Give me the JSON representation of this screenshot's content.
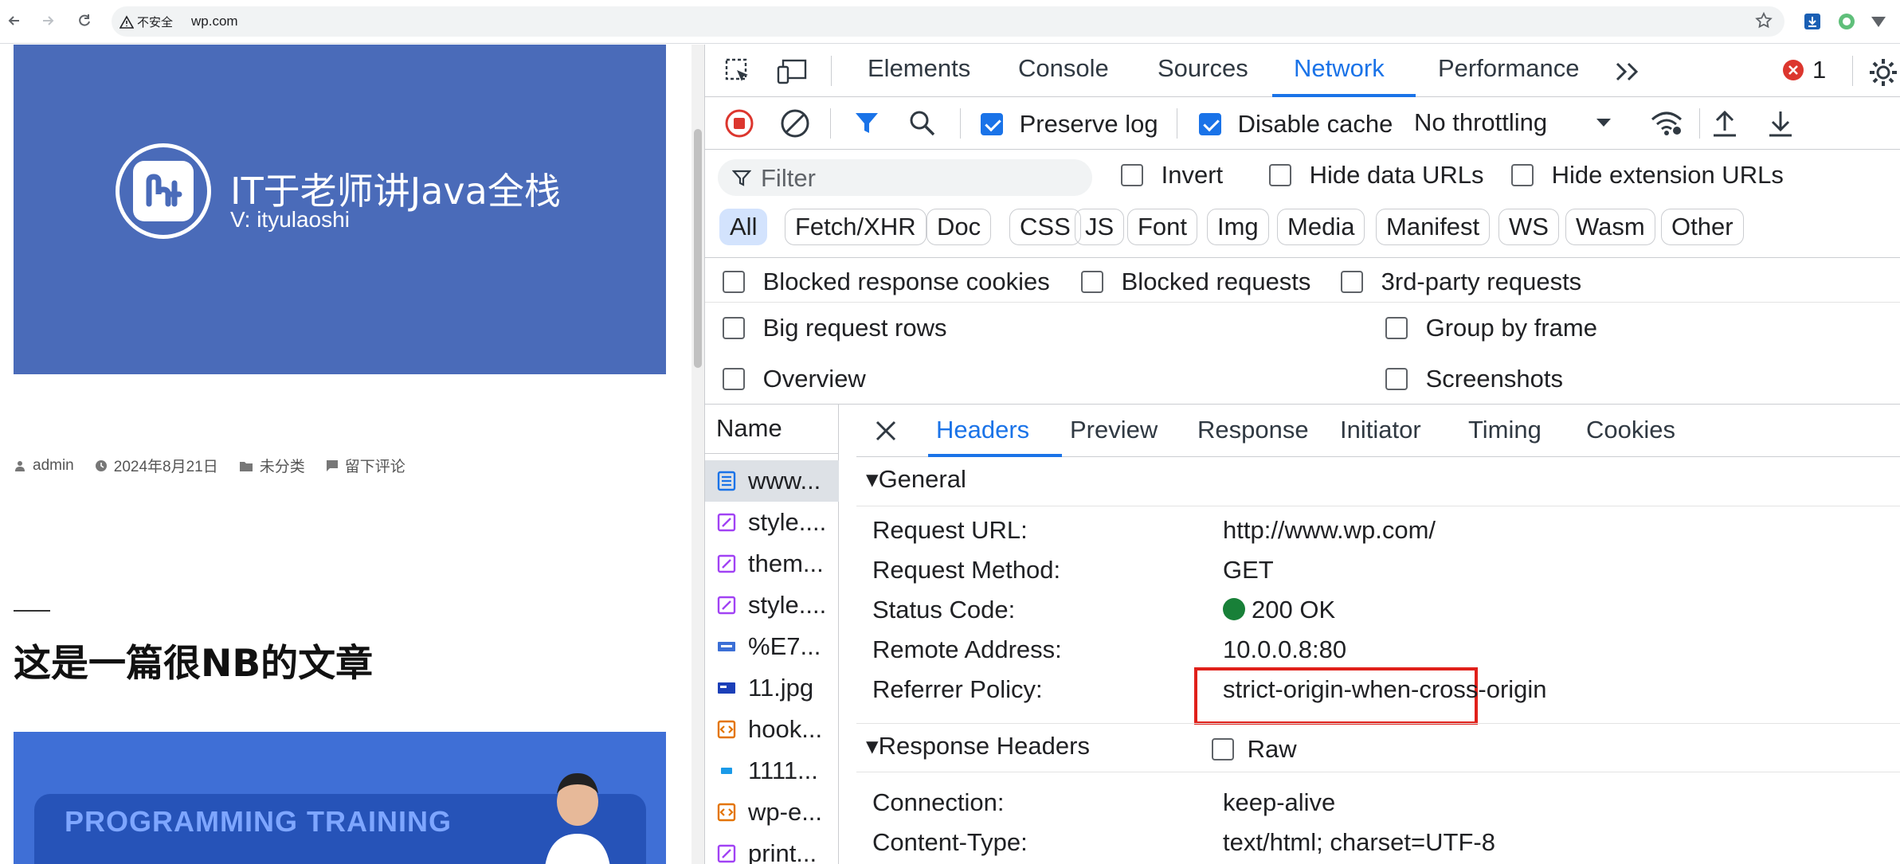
{
  "browser": {
    "security_label": "不安全",
    "url": "wp.com"
  },
  "page": {
    "hero_title": "IT于老师讲Java全栈",
    "hero_subtitle": "V: ityulaoshi",
    "meta": {
      "author": "admin",
      "date": "2024年8月21日",
      "category": "未分类",
      "comment": "留下评论"
    },
    "post_title": "这是一篇很NB的文章",
    "banner_text": "PROGRAMMING TRAINING"
  },
  "devtools": {
    "tabs": [
      "Elements",
      "Console",
      "Sources",
      "Network",
      "Performance"
    ],
    "active_tab": "Network",
    "error_count": "1",
    "toolbar": {
      "preserve_log": "Preserve log",
      "disable_cache": "Disable cache",
      "throttling": "No throttling"
    },
    "filter": {
      "placeholder": "Filter",
      "invert": "Invert",
      "hide_data_urls": "Hide data URLs",
      "hide_extension_urls": "Hide extension URLs",
      "types": [
        "All",
        "Fetch/XHR",
        "Doc",
        "CSS",
        "JS",
        "Font",
        "Img",
        "Media",
        "Manifest",
        "WS",
        "Wasm",
        "Other"
      ],
      "active_type": "All"
    },
    "options": {
      "blocked_cookies": "Blocked response cookies",
      "blocked_requests": "Blocked requests",
      "third_party": "3rd-party requests",
      "big_rows": "Big request rows",
      "group_by_frame": "Group by frame",
      "overview": "Overview",
      "screenshots": "Screenshots"
    },
    "name_header": "Name",
    "requests": [
      {
        "name": "www...",
        "type": "doc"
      },
      {
        "name": "style....",
        "type": "css"
      },
      {
        "name": "them...",
        "type": "css"
      },
      {
        "name": "style....",
        "type": "css"
      },
      {
        "name": "%E7...",
        "type": "img"
      },
      {
        "name": "11.jpg",
        "type": "img"
      },
      {
        "name": "hook...",
        "type": "js"
      },
      {
        "name": "1111...",
        "type": "img"
      },
      {
        "name": "wp-e...",
        "type": "js"
      },
      {
        "name": "print...",
        "type": "css"
      }
    ],
    "detail_tabs": [
      "Headers",
      "Preview",
      "Response",
      "Initiator",
      "Timing",
      "Cookies"
    ],
    "active_detail_tab": "Headers",
    "general": {
      "title": "General",
      "rows": [
        {
          "key": "Request URL:",
          "value": "http://www.wp.com/"
        },
        {
          "key": "Request Method:",
          "value": "GET"
        },
        {
          "key": "Status Code:",
          "value": "200 OK"
        },
        {
          "key": "Remote Address:",
          "value": "10.0.0.8:80"
        },
        {
          "key": "Referrer Policy:",
          "value": "strict-origin-when-cross-origin"
        }
      ]
    },
    "response_headers": {
      "title": "Response Headers",
      "raw_label": "Raw",
      "rows": [
        {
          "key": "Connection:",
          "value": "keep-alive"
        },
        {
          "key": "Content-Type:",
          "value": "text/html; charset=UTF-8"
        }
      ]
    }
  },
  "colors": {
    "accent": "#1a73e8",
    "hero_bg": "#4a6bb9",
    "status_ok": "#188038",
    "highlight_box": "#e0201a"
  }
}
